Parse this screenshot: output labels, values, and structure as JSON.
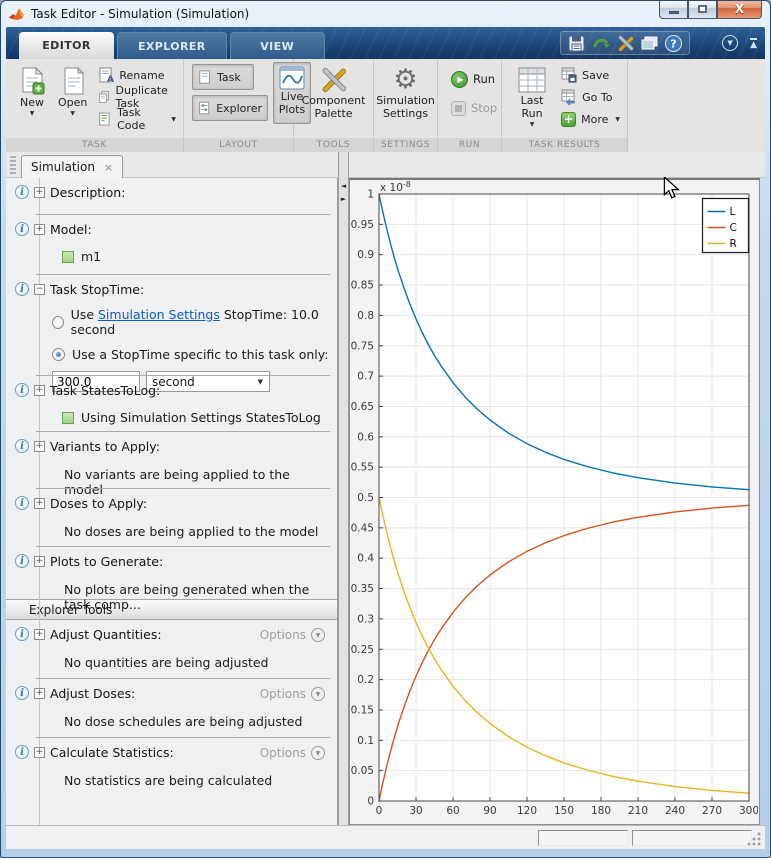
{
  "window": {
    "title": "Task Editor - Simulation (Simulation)"
  },
  "tabs": {
    "editor": "EDITOR",
    "explorer": "EXPLORER",
    "view": "VIEW"
  },
  "ribbon": {
    "sections": {
      "task": "TASK",
      "layout": "LAYOUT",
      "tools": "TOOLS",
      "settings": "SETTINGS",
      "run": "RUN",
      "task_results": "TASK RESULTS"
    },
    "buttons": {
      "new": "New",
      "open": "Open",
      "rename": "Rename",
      "duplicate_task": "Duplicate Task",
      "task_code": "Task Code",
      "task": "Task",
      "explorer": "Explorer",
      "live_plots_1": "Live",
      "live_plots_2": "Plots",
      "component_palette_1": "Component",
      "component_palette_2": "Palette",
      "simulation_settings_1": "Simulation",
      "simulation_settings_2": "Settings",
      "run": "Run",
      "stop": "Stop",
      "last_run": "Last Run",
      "save": "Save",
      "go_to": "Go To",
      "more": "More"
    }
  },
  "task_tab": {
    "label": "Simulation"
  },
  "panel": {
    "description": {
      "title": "Description:"
    },
    "model": {
      "title": "Model:",
      "value": "m1"
    },
    "stoptime": {
      "title": "Task StopTime:",
      "option1_prefix": "Use",
      "option1_link": "Simulation Settings",
      "option1_suffix": "StopTime: 10.0 second",
      "option2": "Use a StopTime specific to this task only:",
      "value": "300.0",
      "unit": "second"
    },
    "states": {
      "title": "Task StatesToLog:",
      "value": "Using Simulation Settings StatesToLog"
    },
    "variants": {
      "title": "Variants to Apply:",
      "note": "No variants are being applied to the model"
    },
    "doses": {
      "title": "Doses to Apply:",
      "note": "No doses are being applied to the model"
    },
    "plots": {
      "title": "Plots to Generate:",
      "note": "No plots are being generated when the task comp..."
    },
    "explorer_tools": {
      "header": "Explorer Tools",
      "options_label": "Options",
      "adjust_quantities": {
        "title": "Adjust Quantities:",
        "note": "No quantities are being adjusted"
      },
      "adjust_doses": {
        "title": "Adjust Doses:",
        "note": "No dose schedules are being adjusted"
      },
      "calculate_statistics": {
        "title": "Calculate Statistics:",
        "note": "No statistics are being calculated"
      }
    }
  },
  "status_bar": {
    "field1": "",
    "field2": ""
  },
  "icons": {
    "chevron_down": "▼",
    "tab_close": "×",
    "expand": "+",
    "collapse": "−",
    "info": "i",
    "help": "?",
    "gear": "⚙",
    "play": "▶",
    "splitter_left": "◄",
    "splitter_right": "►"
  },
  "colors": {
    "accent_blue": "#0072BD",
    "accent_orange": "#D95319",
    "accent_yellow": "#EDB120",
    "link": "#0b5cc4"
  },
  "chart_data": {
    "type": "line",
    "title": "",
    "exponent_label": "x 10",
    "exponent_power": "-8",
    "xlim": [
      0,
      300
    ],
    "ylim": [
      0,
      1
    ],
    "grid": true,
    "xticks": [
      0,
      30,
      60,
      90,
      120,
      150,
      180,
      210,
      240,
      270,
      300
    ],
    "xtick_labels": [
      "0",
      "30",
      "60",
      "90",
      "120",
      "150",
      "180",
      "210",
      "240",
      "270",
      "300"
    ],
    "yticks": [
      0,
      0.05,
      0.1,
      0.15,
      0.2,
      0.25,
      0.3,
      0.35,
      0.4,
      0.45,
      0.5,
      0.55,
      0.6,
      0.65,
      0.7,
      0.75,
      0.8,
      0.85,
      0.9,
      0.95,
      1
    ],
    "ytick_labels": [
      "0",
      "0.05",
      "0.1",
      "0.15",
      "0.2",
      "0.25",
      "0.3",
      "0.35",
      "0.4",
      "0.45",
      "0.5",
      "0.55",
      "0.6",
      "0.65",
      "0.7",
      "0.75",
      "0.8",
      "0.85",
      "0.9",
      "0.95",
      "1"
    ],
    "legend": {
      "position": "northeast",
      "entries": [
        "L",
        "C",
        "R"
      ]
    },
    "x": [
      0,
      1,
      2,
      3,
      5,
      7,
      10,
      13,
      16,
      20,
      25,
      30,
      35,
      40,
      45,
      50,
      60,
      70,
      80,
      90,
      105,
      120,
      135,
      150,
      170,
      190,
      210,
      240,
      270,
      300
    ],
    "series": [
      {
        "name": "L",
        "color": "#0072BD",
        "values": [
          1,
          0.9901,
          0.9806,
          0.9713,
          0.9535,
          0.9367,
          0.9131,
          0.8913,
          0.8712,
          0.8466,
          0.8189,
          0.7942,
          0.772,
          0.7521,
          0.734,
          0.7176,
          0.6891,
          0.6652,
          0.6449,
          0.6276,
          0.606,
          0.5887,
          0.5744,
          0.5628,
          0.5503,
          0.5404,
          0.5326,
          0.5238,
          0.5174,
          0.5128
        ]
      },
      {
        "name": "C",
        "color": "#D95319",
        "values": [
          0,
          0.0099,
          0.0194,
          0.0287,
          0.0465,
          0.0633,
          0.0869,
          0.1087,
          0.1288,
          0.1534,
          0.1811,
          0.2058,
          0.228,
          0.2479,
          0.266,
          0.2824,
          0.3109,
          0.3348,
          0.3551,
          0.3724,
          0.394,
          0.4113,
          0.4256,
          0.4372,
          0.4497,
          0.4596,
          0.4674,
          0.4762,
          0.4826,
          0.4872
        ]
      },
      {
        "name": "R",
        "color": "#EDB120",
        "values": [
          0.5,
          0.4901,
          0.4806,
          0.4713,
          0.4535,
          0.4367,
          0.4131,
          0.3913,
          0.3712,
          0.3466,
          0.3189,
          0.2942,
          0.272,
          0.2521,
          0.234,
          0.2176,
          0.1891,
          0.1652,
          0.1449,
          0.1276,
          0.106,
          0.0887,
          0.0744,
          0.0628,
          0.0503,
          0.0404,
          0.0326,
          0.0238,
          0.0174,
          0.0128
        ]
      }
    ]
  }
}
